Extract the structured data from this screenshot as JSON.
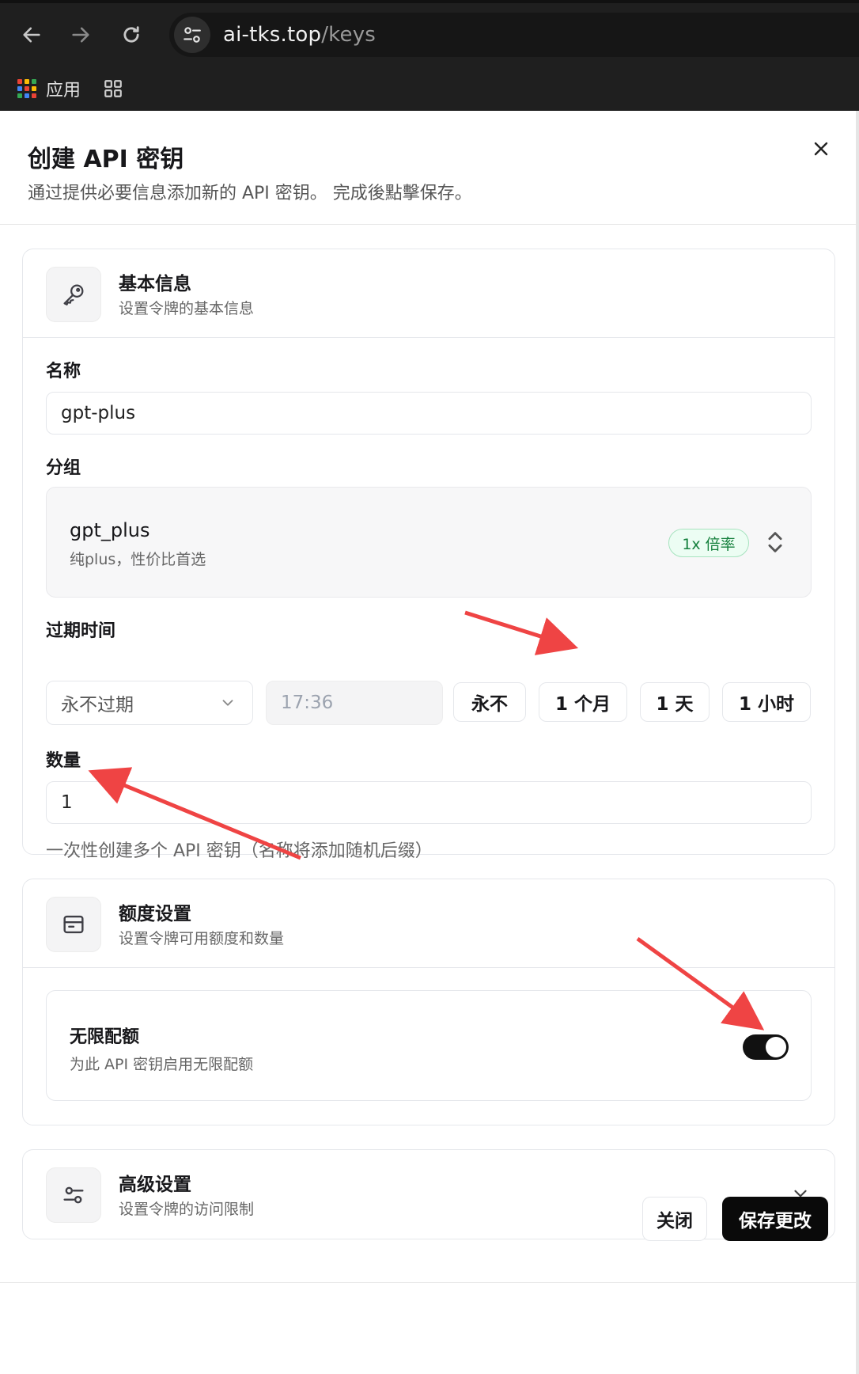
{
  "browser": {
    "url_host": "ai-tks.top",
    "url_path": "/keys",
    "bookmark_apps_label": "应用"
  },
  "dialog": {
    "title": "创建 API 密钥",
    "description": "通过提供必要信息添加新的 API 密钥。 完成後點擊保存。",
    "basic": {
      "title": "基本信息",
      "subtitle": "设置令牌的基本信息",
      "name_label": "名称",
      "name_value": "gpt-plus",
      "group_label": "分组",
      "group_name": "gpt_plus",
      "group_desc": "纯plus，性价比首选",
      "group_badge": "1x 倍率",
      "expire_label": "过期时间",
      "expire_select": "永不过期",
      "expire_time": "17:36",
      "quick_never": "永不",
      "quick_month": "1 个月",
      "quick_day": "1 天",
      "quick_hour": "1 小时",
      "quantity_label": "数量",
      "quantity_value": "1",
      "quantity_hint": "一次性创建多个 API 密钥（名称将添加随机后缀）"
    },
    "quota": {
      "title": "额度设置",
      "subtitle": "设置令牌可用额度和数量",
      "unlimited_title": "无限配额",
      "unlimited_desc": "为此 API 密钥启用无限配额",
      "unlimited_enabled": true
    },
    "advanced": {
      "title": "高级设置",
      "subtitle": "设置令牌的访问限制"
    },
    "footer": {
      "close_label": "关闭",
      "save_label": "保存更改"
    }
  },
  "colors": {
    "accent": "#0a0a0a",
    "badge_green": "#15803d",
    "annotation_arrow": "#ef4444"
  }
}
